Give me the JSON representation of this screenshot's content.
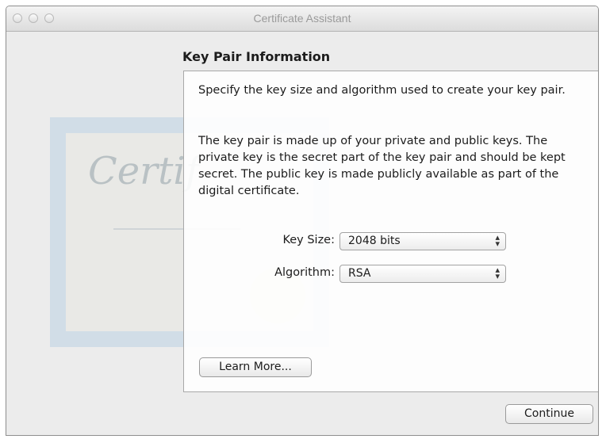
{
  "window": {
    "title": "Certificate Assistant"
  },
  "page": {
    "heading": "Key Pair Information",
    "intro": "Specify the key size and algorithm used to create your key pair.",
    "description": "The key pair is made up of your private and public keys. The private key is the secret part of the key pair and should be kept secret. The public key is made publicly available as part of the digital certificate."
  },
  "form": {
    "key_size": {
      "label": "Key Size:",
      "value": "2048 bits"
    },
    "algorithm": {
      "label": "Algorithm:",
      "value": "RSA"
    }
  },
  "buttons": {
    "learn_more": "Learn More...",
    "continue": "Continue"
  },
  "background": {
    "script_text": "Certif"
  },
  "icons": {
    "popup": "updown-arrows-icon"
  }
}
